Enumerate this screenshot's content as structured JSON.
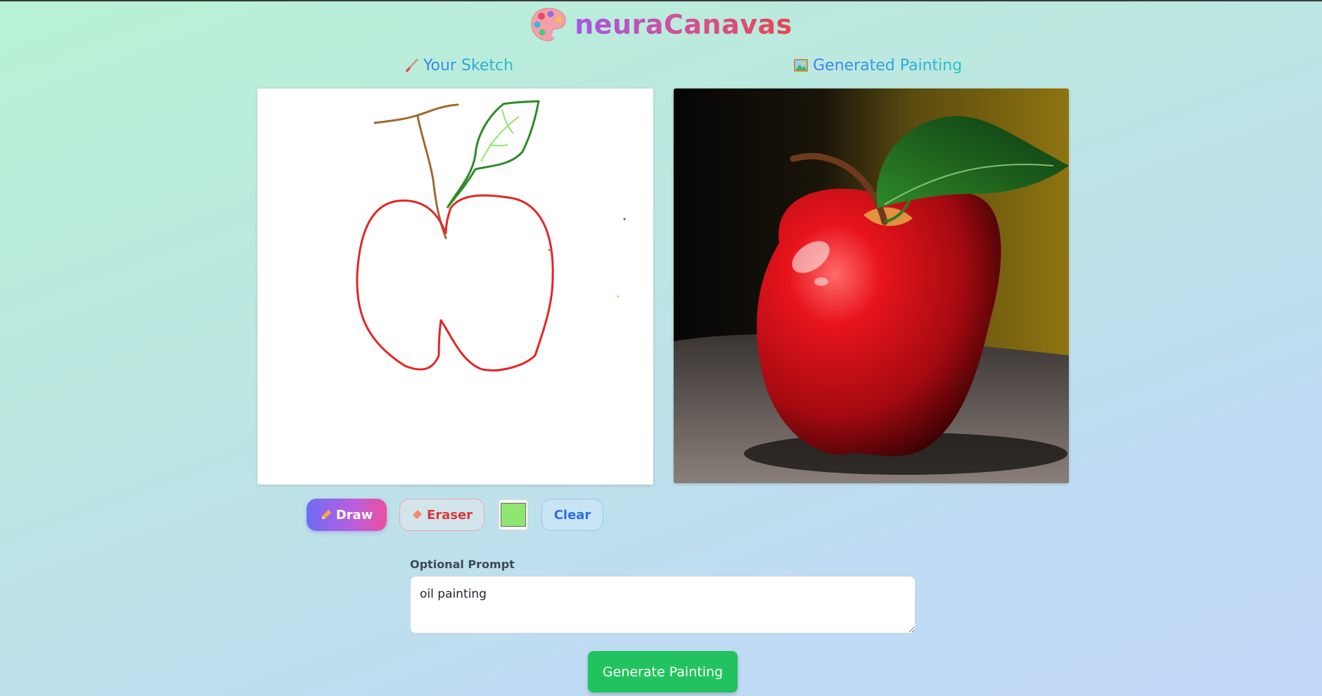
{
  "app": {
    "title": "neuraCanavas",
    "icon": "artist-palette-icon"
  },
  "sketch_panel": {
    "heading_icon": "paintbrush-icon",
    "heading": "Your Sketch"
  },
  "painting_panel": {
    "heading_icon": "framed-picture-icon",
    "heading": "Generated Painting"
  },
  "toolbar": {
    "draw_label": "Draw",
    "draw_icon": "pencil-icon",
    "eraser_label": "Eraser",
    "eraser_icon": "eraser-icon",
    "clear_label": "Clear",
    "selected_color": "#8fe66f"
  },
  "prompt": {
    "label": "Optional Prompt",
    "value": "oil painting"
  },
  "generate_label": "Generate Painting",
  "colors": {
    "draw_gradient_start": "#6f6cf3",
    "draw_gradient_end": "#ec4f9e",
    "generate_button": "#22c35e",
    "sketch_apple": "#e32626",
    "sketch_stem": "#a0692e",
    "sketch_leaf": "#2e8b24"
  }
}
